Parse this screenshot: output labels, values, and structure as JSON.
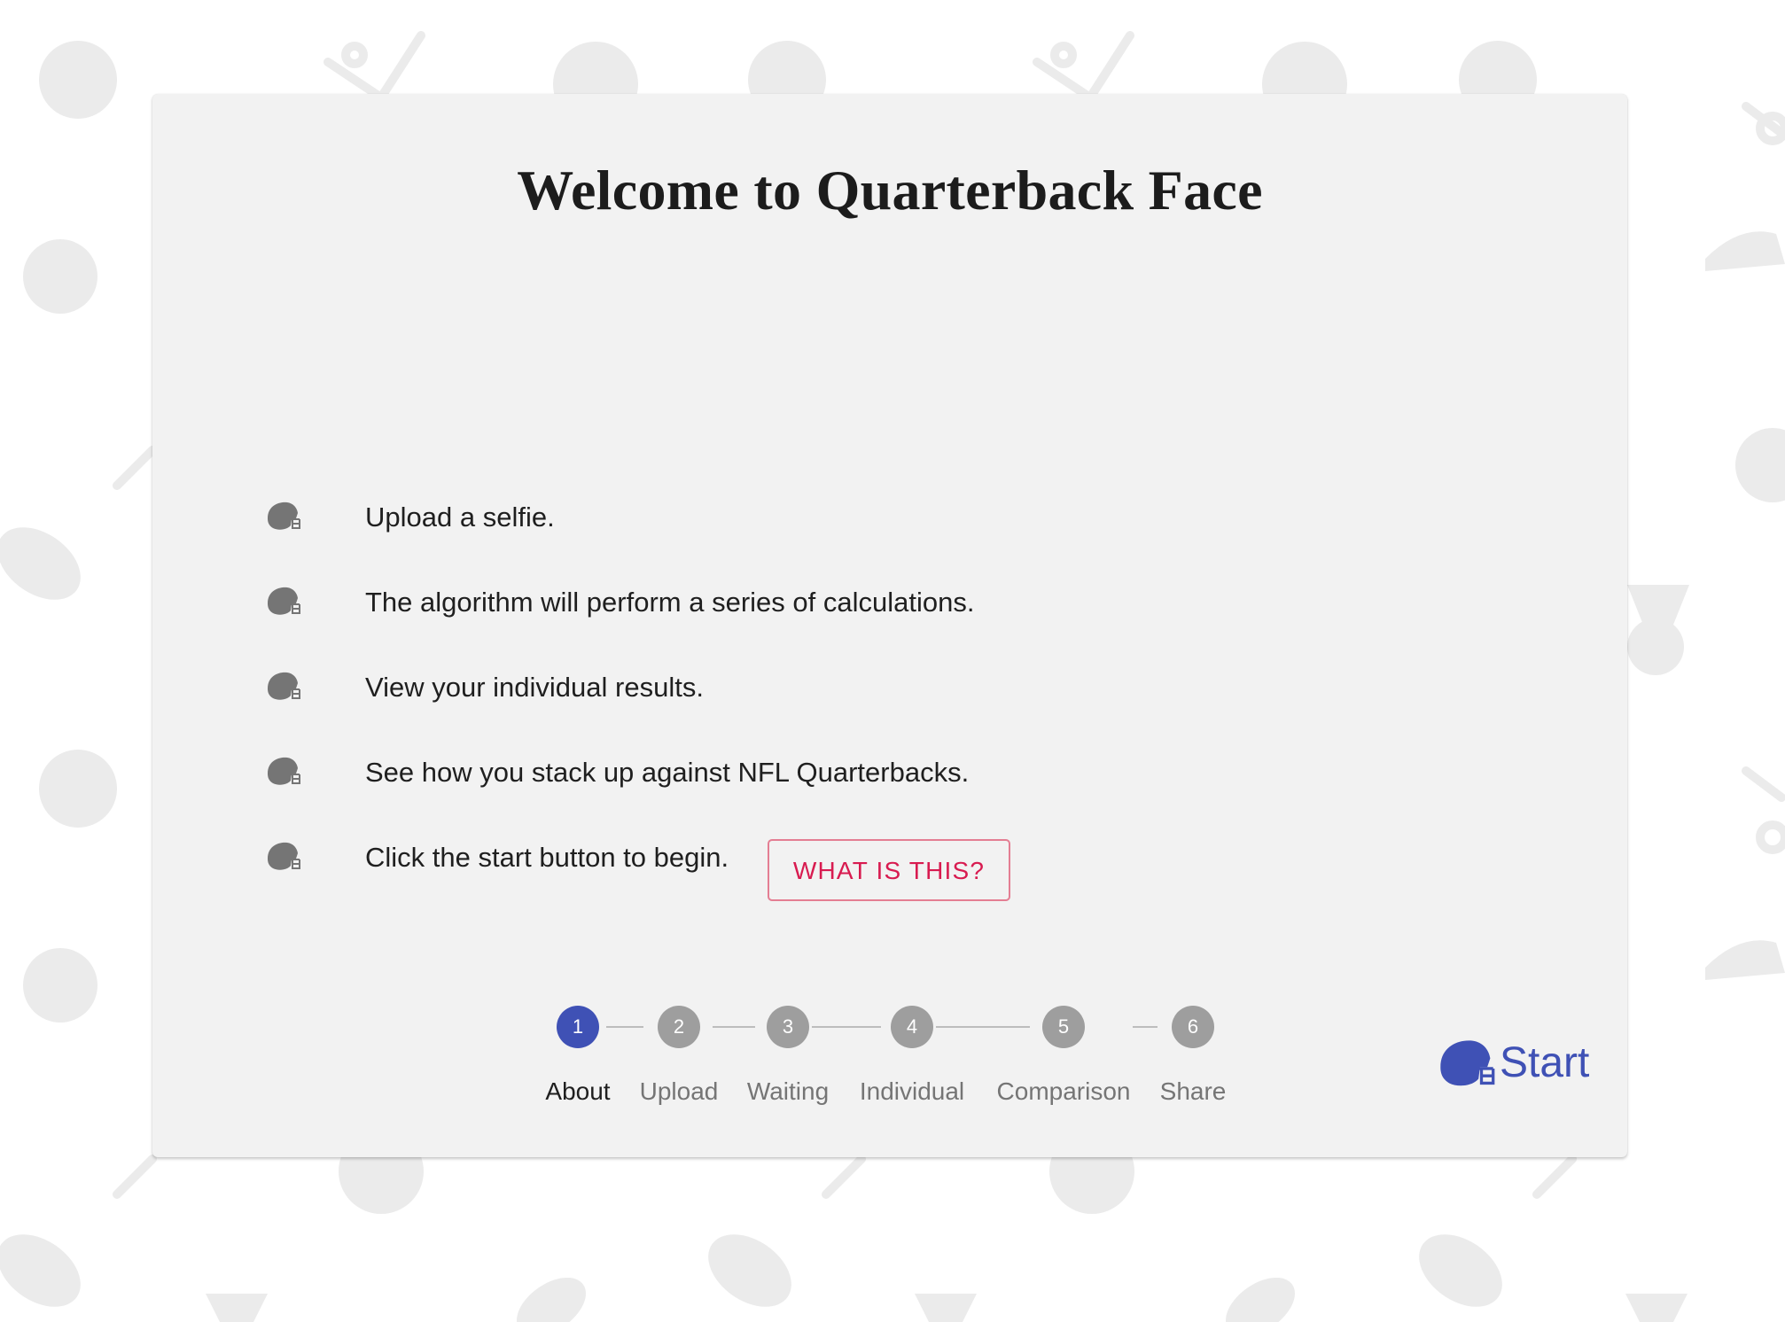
{
  "page": {
    "title": "Welcome to Quarterback Face"
  },
  "instructions": [
    {
      "text": "Upload a selfie.",
      "icon": "helmet-icon"
    },
    {
      "text": "The algorithm will perform a series of calculations.",
      "icon": "helmet-icon"
    },
    {
      "text": "View your individual results.",
      "icon": "helmet-icon"
    },
    {
      "text": "See how you stack up against NFL Quarterbacks.",
      "icon": "helmet-icon"
    },
    {
      "text": "Click the start button to begin.",
      "icon": "helmet-icon"
    }
  ],
  "buttons": {
    "what_is_this": "WHAT IS THIS?",
    "start": "Start"
  },
  "stepper": {
    "active_step": 1,
    "steps": [
      {
        "number": "1",
        "label": "About"
      },
      {
        "number": "2",
        "label": "Upload"
      },
      {
        "number": "3",
        "label": "Waiting"
      },
      {
        "number": "4",
        "label": "Individual"
      },
      {
        "number": "5",
        "label": "Comparison"
      },
      {
        "number": "6",
        "label": "Share"
      }
    ]
  },
  "colors": {
    "accent": "#3f51b5",
    "secondary": "#d81b50",
    "inactive_step": "#9e9e9e",
    "card_background": "#f2f2f2",
    "background_pattern": "#ebebeb"
  },
  "background_icons": [
    "soccer-ball-icon",
    "baseball-bat-icon",
    "basketball-icon",
    "tennis-ball-icon",
    "football-icon",
    "sneaker-icon",
    "medal-icon",
    "tennis-racket-icon"
  ]
}
